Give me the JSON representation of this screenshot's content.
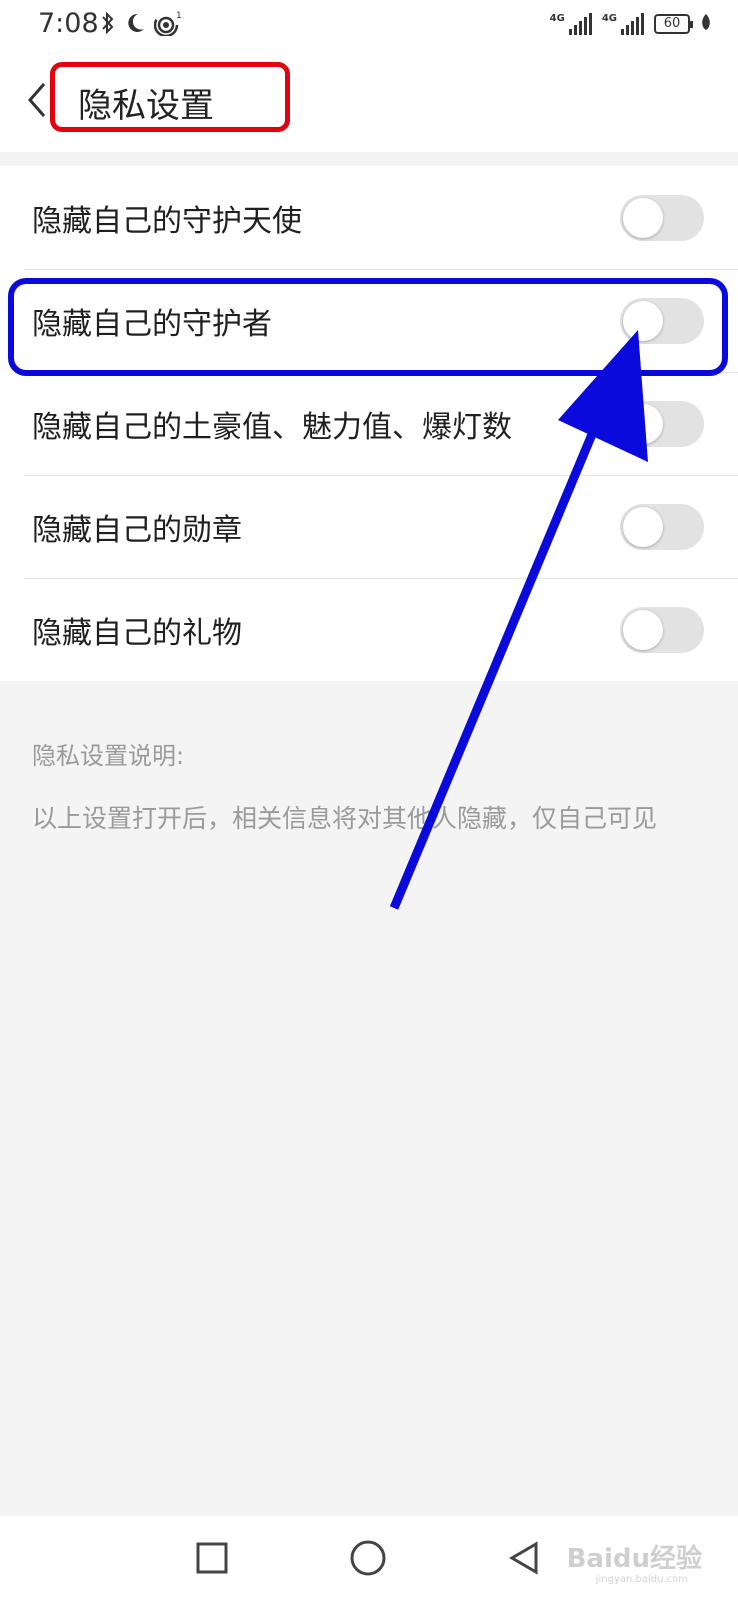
{
  "status_bar": {
    "time": "7:08",
    "network_left": "4G",
    "network_right": "4G",
    "battery": "60",
    "icons_left": [
      "bluetooth-icon",
      "moon-icon",
      "hotspot-icon"
    ]
  },
  "header": {
    "title": "隐私设置",
    "back_icon": "chevron-left-icon"
  },
  "settings": {
    "items": [
      {
        "label": "隐藏自己的守护天使",
        "enabled": false
      },
      {
        "label": "隐藏自己的守护者",
        "enabled": false
      },
      {
        "label": "隐藏自己的土豪值、魅力值、爆灯数",
        "enabled": false
      },
      {
        "label": "隐藏自己的勋章",
        "enabled": false
      },
      {
        "label": "隐藏自己的礼物",
        "enabled": false
      }
    ]
  },
  "description": {
    "title": "隐私设置说明:",
    "body": "以上设置打开后，相关信息将对其他人隐藏，仅自己可见"
  },
  "nav_bar": {
    "buttons": [
      "recents-square-icon",
      "home-circle-icon",
      "back-triangle-icon"
    ],
    "watermark": "Baidu经验",
    "watermark_sub": "jingyan.baidu.com"
  },
  "colors": {
    "title_highlight": "#e3000f",
    "row_highlight": "#0a0adc",
    "arrow": "#0a0adc",
    "toggle_off": "#e2e2e2",
    "background": "#f4f4f4"
  }
}
